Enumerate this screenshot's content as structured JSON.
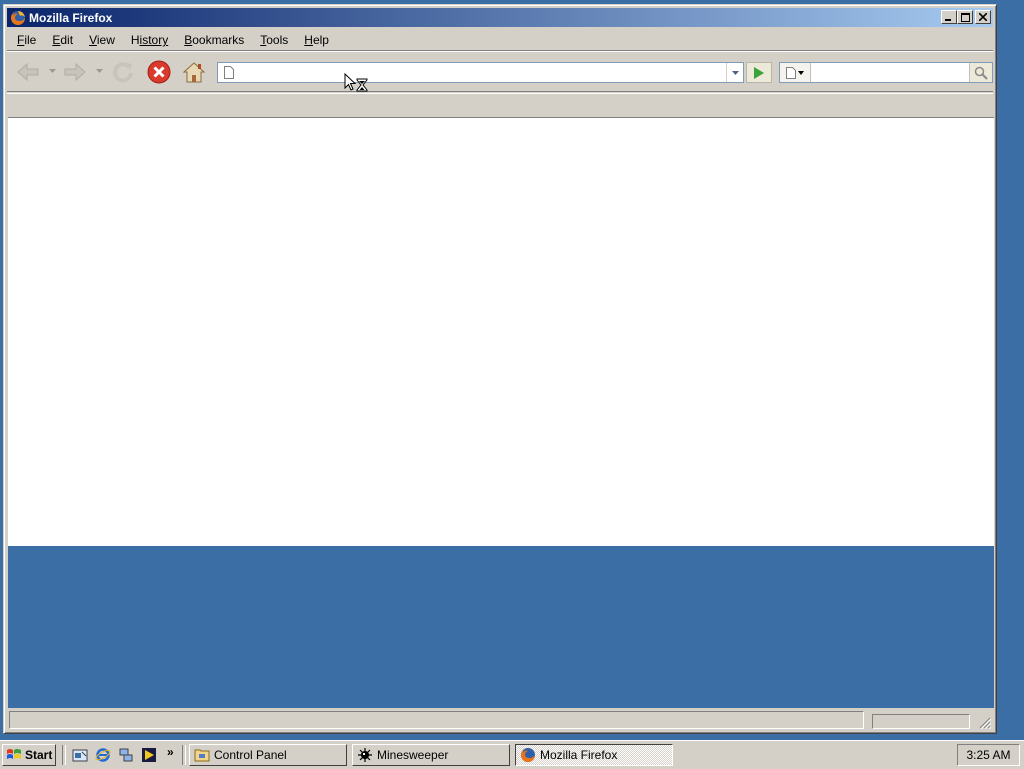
{
  "window": {
    "title": "Mozilla Firefox",
    "buttons": {
      "minimize": "minimize",
      "maximize": "maximize",
      "close": "close"
    }
  },
  "menu": [
    {
      "label": "File",
      "accel": "F",
      "rest": "ile"
    },
    {
      "label": "Edit",
      "accel": "E",
      "rest": "dit"
    },
    {
      "label": "View",
      "accel": "V",
      "rest": "iew"
    },
    {
      "label": "History",
      "accel": "H",
      "rest": "istory",
      "accel_pos": "start"
    },
    {
      "label": "Bookmarks",
      "accel": "B",
      "rest": "ookmarks"
    },
    {
      "label": "Tools",
      "accel": "T",
      "rest": "ools"
    },
    {
      "label": "Help",
      "accel": "H",
      "rest": "elp"
    }
  ],
  "navbar": {
    "url_value": "",
    "url_placeholder": "",
    "search_value": "",
    "search_placeholder": ""
  },
  "icons": {
    "back": "back-arrow-icon",
    "forward": "forward-arrow-icon",
    "reload": "reload-icon",
    "stop": "stop-icon",
    "home": "home-icon",
    "page": "page-icon",
    "go": "go-arrow-icon",
    "search": "magnifier-icon"
  },
  "status": {
    "text": ""
  },
  "taskbar": {
    "start_label": "Start",
    "tasks": [
      {
        "label": "Control Panel",
        "active": false
      },
      {
        "label": "Minesweeper",
        "active": false
      },
      {
        "label": "Mozilla Firefox",
        "active": true
      }
    ],
    "clock": "3:25 AM",
    "more": "»"
  },
  "colors": {
    "desktop": "#3a6ea5",
    "chrome": "#d4d0c8",
    "titlebar_start": "#0a246a",
    "titlebar_end": "#a6caf0"
  }
}
